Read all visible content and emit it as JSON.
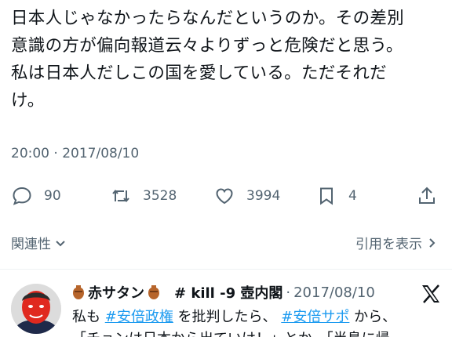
{
  "tweet": {
    "text_lines": [
      "日本人じゃなかったらなんだというのか。その差別",
      "意識の方が偏向報道云々よりずっと危険だと思う。",
      "私は日本人だしこの国を愛している。ただそれだ",
      "け。"
    ],
    "timestamp": "20:00 · 2017/08/10"
  },
  "actions": {
    "replies": "90",
    "retweets": "3528",
    "likes": "3994",
    "bookmarks": "4"
  },
  "subbar": {
    "related_label": "関連性",
    "quotes_label": "引用を表示"
  },
  "reply": {
    "display_name": "赤サタン",
    "handle": "# kill -9 壺内閣",
    "separator": "·",
    "date": "2017/08/10",
    "line1_prefix": "私も ",
    "hashtag1": "#安倍政権",
    "line1_mid": " を批判したら、 ",
    "hashtag2": "#安倍サポ",
    "line1_suffix": " から、",
    "line2": "「チョンは日本から出ていけ！」とか、「半島に帰"
  },
  "icons": {
    "reply": "speech-bubble-icon",
    "retweet": "retweet-icon",
    "like": "heart-icon",
    "bookmark": "bookmark-icon",
    "share": "share-icon",
    "chevron": "chevron-down-icon",
    "quote_chevron": "chevron-right-icon",
    "urn": "urn-emoji-icon",
    "x_logo": "x-logo-icon"
  },
  "colors": {
    "text": "#0f1419",
    "secondary": "#536471",
    "link": "#1d9bf0"
  }
}
